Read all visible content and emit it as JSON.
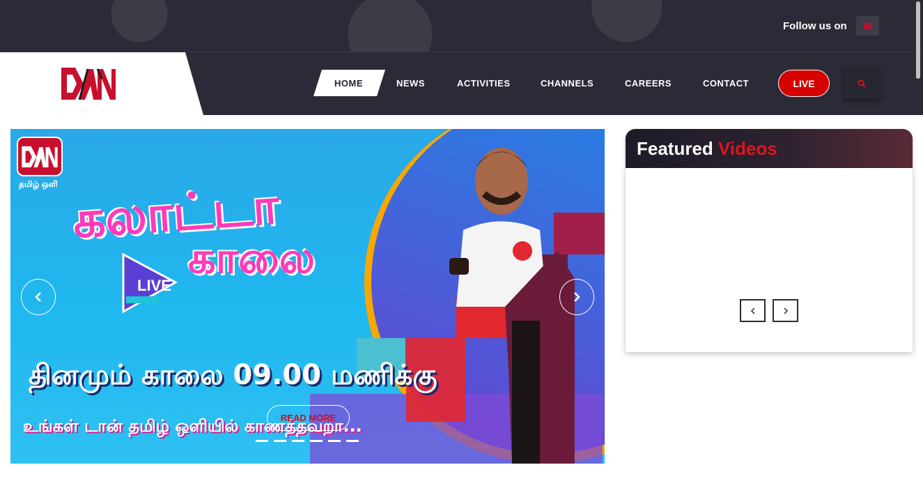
{
  "topbar": {
    "follow_label": "Follow us on",
    "social_icon": "facebook-icon"
  },
  "brand": {
    "logo_text": "DAN",
    "accent_color": "#c8102e"
  },
  "nav": {
    "items": [
      {
        "label": "HOME",
        "active": true
      },
      {
        "label": "NEWS"
      },
      {
        "label": "ACTIVITIES"
      },
      {
        "label": "CHANNELS"
      },
      {
        "label": "CAREERS"
      },
      {
        "label": "CONTACT"
      }
    ],
    "live_label": "LIVE",
    "search_icon": "search-icon"
  },
  "slider": {
    "channel_logo": "DAN",
    "channel_tagline": "தமிழ் ஒளி",
    "title_line1": "கலாட்டா",
    "title_line2": "காலை",
    "live_badge": "LIVE",
    "subtitle": "தினமும் காலை 09.00 மணிக்கு",
    "tagline": "உங்கள் டான் தமிழ் ஒளியில் காணத்தவறா...",
    "read_more": "READ MORE",
    "slide_count": 6,
    "active_slide": 1
  },
  "featured": {
    "title_white": "Featured",
    "title_red": "Videos",
    "prev_icon": "chevron-left-icon",
    "next_icon": "chevron-right-icon"
  }
}
